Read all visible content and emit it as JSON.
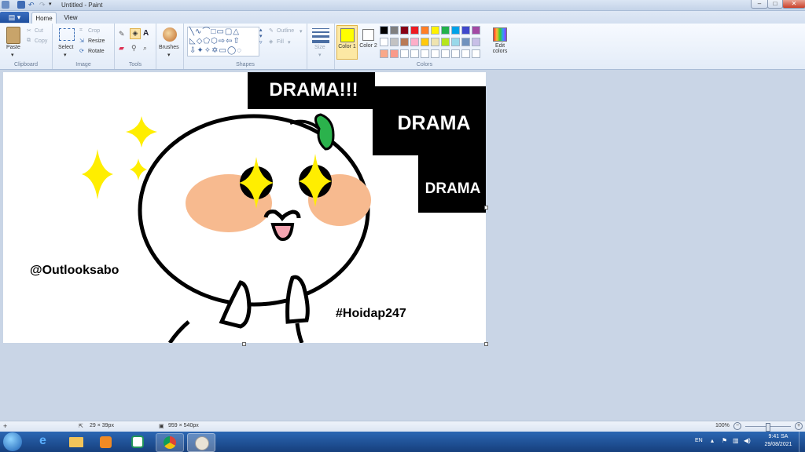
{
  "window": {
    "title": "Untitled - Paint"
  },
  "tabs": {
    "file": "",
    "home": "Home",
    "view": "View"
  },
  "ribbon": {
    "clipboard": {
      "paste": "Paste",
      "cut": "Cut",
      "copy": "Copy",
      "label": "Clipboard"
    },
    "image": {
      "select": "Select",
      "crop": "Crop",
      "resize": "Resize",
      "rotate": "Rotate",
      "label": "Image"
    },
    "tools": {
      "label": "Tools"
    },
    "brushes": {
      "label": "Brushes"
    },
    "shapes": {
      "outline": "Outline",
      "fill": "Fill",
      "label": "Shapes"
    },
    "size": {
      "label": "Size"
    },
    "colors": {
      "color1": "Color 1",
      "color2": "Color 2",
      "edit": "Edit colors",
      "label": "Colors",
      "color1_value": "#ffff00",
      "color2_value": "#ffffff",
      "palette_row1": [
        "#000000",
        "#7f7f7f",
        "#880015",
        "#ed1c24",
        "#ff7f27",
        "#fff200",
        "#22b14c",
        "#00a2e8",
        "#3f48cc",
        "#a349a4"
      ],
      "palette_row2": [
        "#ffffff",
        "#c3c3c3",
        "#b97a57",
        "#ffaec9",
        "#ffc90e",
        "#efe4b0",
        "#b5e61d",
        "#99d9ea",
        "#7092be",
        "#c8bfe7"
      ],
      "palette_row3": [
        "#f9a88a",
        "#f99a8a",
        "#ffffff",
        "#ffffff",
        "#ffffff",
        "#ffffff",
        "#ffffff",
        "#ffffff",
        "#ffffff",
        "#ffffff"
      ]
    }
  },
  "canvas_text": {
    "drama1": "DRAMA!!!",
    "drama2": "DRAMA",
    "drama3": "DRAMA",
    "handle": "@Outlooksabo",
    "hashtag": "#Hoidap247"
  },
  "status": {
    "cursor": "29 × 39px",
    "canvas_size": "959 × 540px",
    "zoom": "100%"
  },
  "taskbar": {
    "lang": "EN",
    "time": "9:41 SA",
    "date": "29/08/2021"
  }
}
